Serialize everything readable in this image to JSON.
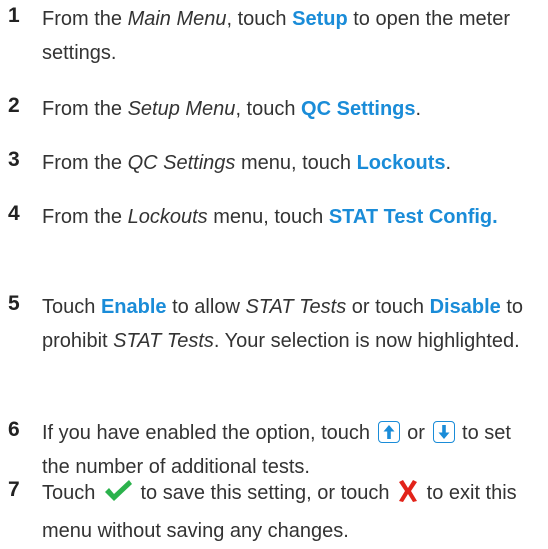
{
  "steps": [
    {
      "num": "1",
      "pre": "From the ",
      "menu": "Main Menu",
      "mid": ", touch ",
      "kw": "Setup",
      "post": " to open the meter settings."
    },
    {
      "num": "2",
      "pre": "From the ",
      "menu": "Setup Menu",
      "mid": ", touch ",
      "kw": "QC Settings",
      "post": "."
    },
    {
      "num": "3",
      "pre": "From the ",
      "menu": "QC Settings",
      "mid": " menu, touch ",
      "kw": "Lockouts",
      "post": "."
    },
    {
      "num": "4",
      "pre": "From the ",
      "menu": "Lockouts",
      "mid": " menu, touch ",
      "kw": "STAT Test Config.",
      "post": ""
    },
    {
      "num": "5",
      "a": "Touch ",
      "kw1": "Enable",
      "b": " to allow ",
      "it1": "STAT Tests",
      "c": " or touch ",
      "kw2": "Disable",
      "d": " to prohibit ",
      "it2": "STAT Tests",
      "e": ". Your selection is now highlighted."
    },
    {
      "num": "6",
      "a": "If you have enabled the option, touch ",
      "b": " or ",
      "c": " to set the number of additional tests."
    },
    {
      "num": "7",
      "a": "Touch ",
      "b": " to save this setting, or touch ",
      "c": " to exit this menu without saving any changes."
    }
  ],
  "icons": {
    "up": "arrow-up-icon",
    "down": "arrow-down-icon",
    "save": "checkmark-icon",
    "exit": "cross-icon"
  },
  "colors": {
    "accent": "#1a8cd8",
    "check": "#2bb24c",
    "cross": "#e2231a"
  }
}
